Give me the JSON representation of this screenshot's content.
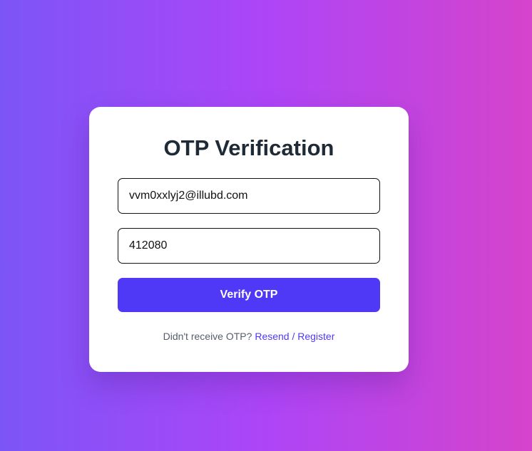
{
  "card": {
    "title": "OTP Verification",
    "email_value": "vvm0xxlyj2@illubd.com",
    "otp_value": "412080",
    "verify_label": "Verify OTP",
    "footer_text": "Didn't receive OTP?",
    "resend_link": "Resend / Register"
  },
  "colors": {
    "accent": "#4f39f6",
    "gradient_start": "#7c55f7",
    "gradient_end": "#d544cb"
  }
}
